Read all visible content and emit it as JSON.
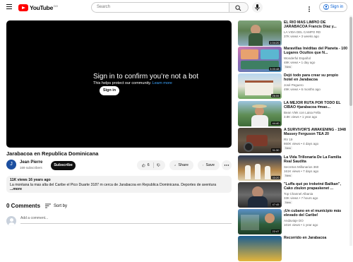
{
  "header": {
    "logo_text": "YouTube",
    "logo_country": "DO",
    "search_placeholder": "Search",
    "signin_label": "Sign in"
  },
  "player": {
    "title": "Sign in to confirm you’re not a bot",
    "subtitle": "This helps protect our community.",
    "learn_more": "Learn more",
    "signin_label": "Sign in"
  },
  "video": {
    "title": "Jarabacoa en Republica Dominicana",
    "channel_initial": "J",
    "channel_name": "Jean Pierre",
    "subscribers": "169 subscribers",
    "subscribe_label": "Subscribe",
    "likes": "6",
    "share_label": "Share",
    "save_label": "Save",
    "description_meta": "11K views  16 years ago",
    "description_text": "La montana la mas alta del Caribe el Pico Duarte 3187 m cerca de Jarabacoa en Republica Dominicana. Deportes de aventura",
    "description_more": "...more"
  },
  "comments": {
    "heading": "0 Comments",
    "sort_label": "Sort by",
    "placeholder": "Add a comment..."
  },
  "recommendations": [
    {
      "title": "EL RIO MAS LIMPIO DE JARABACOA Francis Diaz y...",
      "channel": "LA VIDA DEL CAMPO RD",
      "meta": "37K views • 3 weeks ago",
      "duration": "1:04:20",
      "badge": ""
    },
    {
      "title": "Maravillas Inéditas del Planeta - 100 Lugares Ocultos que N...",
      "channel": "Wonderful Español",
      "meta": "48K views • 1 day ago",
      "duration": "3:00:48",
      "badge": "New"
    },
    {
      "title": "Dejó todo para crear su propio hotel en Jarabacoa",
      "channel": "José Peguero",
      "meta": "49K views • 6 months ago",
      "duration": "26:06",
      "badge": ""
    },
    {
      "title": "LA MEJOR RUTA POR TODO EL CIBAO #jarabacoa #mao...",
      "channel": "Bean Vlek con Laisa Fella",
      "meta": "3.8K views • 1 year ago",
      "duration": "44:40",
      "badge": ""
    },
    {
      "title": "A SURVIVOR'S AWAKENING - 1948 Massey Ferguson TEA 20",
      "channel": "RV 19",
      "meta": "860K views • 4 days ago",
      "duration": "31:30",
      "badge": "New"
    },
    {
      "title": "La Vida Trillonaria De La Familia Real Saudita",
      "channel": "Secretos Millonarios 360",
      "meta": "161K views • 7 days ago",
      "duration": "33:20",
      "badge": "New"
    },
    {
      "title": "\"Luffa qué po troketné Bailkan\", Cako zbulon prapaskenet ...",
      "channel": "Top Channel Albania",
      "meta": "33K views • 7 hours ago",
      "duration": "47:45",
      "badge": "New"
    },
    {
      "title": "¡Un cubano en el municipio más elevado del Caribe!",
      "channel": "Andaviaje DO",
      "meta": "101K views • 1 year ago",
      "duration": "22:47",
      "badge": ""
    },
    {
      "title": "Recorrido en Jarabacoa",
      "channel": "",
      "meta": "",
      "duration": "",
      "badge": ""
    }
  ],
  "colors": {
    "brand_red": "#ff0000",
    "link_blue": "#065fd4",
    "player_bg": "#000000"
  }
}
